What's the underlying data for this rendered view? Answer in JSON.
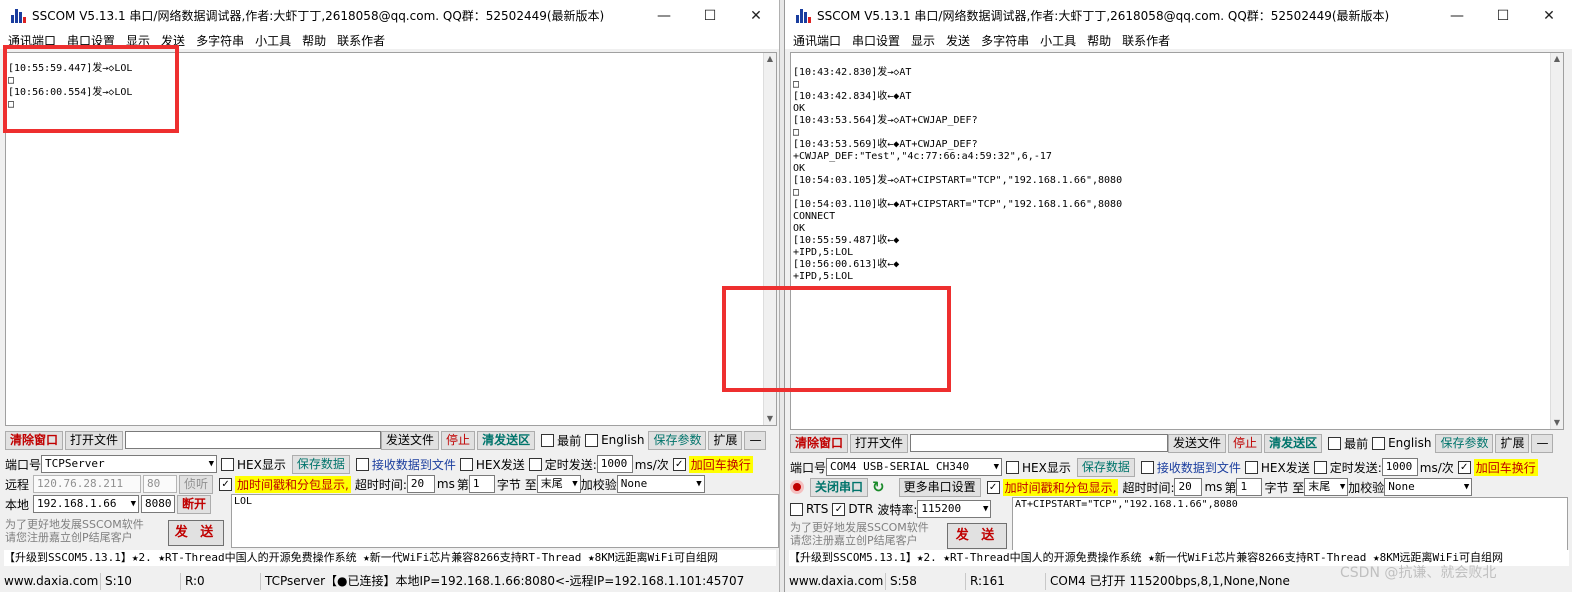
{
  "left": {
    "title": "SSCOM V5.13.1 串口/网络数据调试器,作者:大虾丁丁,2618058@qq.com. QQ群：52502449(最新版本)",
    "menu": [
      "通讯端口",
      "串口设置",
      "显示",
      "发送",
      "多字符串",
      "小工具",
      "帮助",
      "联系作者"
    ],
    "log": [
      "[10:55:59.447]发→◇LOL",
      "□",
      "[10:56:00.554]发→◇LOL",
      "□"
    ],
    "toolbar": {
      "clear": "清除窗口",
      "open_file": "打开文件",
      "send_file": "发送文件",
      "stop": "停止",
      "clear_send": "清发送区",
      "top": "最前",
      "english": "English",
      "save_params": "保存参数",
      "expand": "扩展",
      "collapse": "—"
    },
    "port_label": "端口号",
    "port_value": "TCPServer",
    "hex_display": "HEX显示",
    "save_data": "保存数据",
    "recv_to_file": "接收数据到文件",
    "hex_send": "HEX发送",
    "timed_send": "定时发送:",
    "interval": "1000",
    "interval_unit": "ms/次",
    "add_crlf": "加回车换行",
    "remote_label": "远程",
    "remote_ip": "120.76.28.211",
    "remote_port": "80",
    "listen": "侦听",
    "timestamp_label": "加时间戳和分包显示,",
    "timeout_label": "超时时间:",
    "timeout": "20",
    "timeout_unit": "ms",
    "seg_label": "第",
    "seg_value": "1",
    "byte_to": "字节 至",
    "tail": "末尾",
    "checksum_label": "加校验",
    "checksum": "None",
    "local_label": "本地",
    "local_ip": "192.168.1.66",
    "local_port": "8080",
    "disconnect": "断开",
    "send_text": "LOL",
    "promo_line1": "为了更好地发展SSCOM软件",
    "promo_line2": "请您注册嘉立创P结尾客户",
    "send_button": "发 送",
    "ticker": "【升级到SSCOM5.13.1】★2. ★RT-Thread中国人的开源免费操作系统 ★新一代WiFi芯片兼容8266支持RT-Thread ★8KM远距离WiFi可自组网",
    "status": {
      "site": "www.daxia.com",
      "sent": "S:10",
      "recv": "R:0",
      "info": "TCPserver【●已连接】本地IP=192.168.1.66:8080<-远程IP=192.168.1.101:45707"
    }
  },
  "right": {
    "title": "SSCOM V5.13.1 串口/网络数据调试器,作者:大虾丁丁,2618058@qq.com. QQ群：52502449(最新版本)",
    "menu": [
      "通讯端口",
      "串口设置",
      "显示",
      "发送",
      "多字符串",
      "小工具",
      "帮助",
      "联系作者"
    ],
    "log": [
      "[10:43:42.830]发→◇AT",
      "□",
      "[10:43:42.834]收←◆AT",
      "",
      "OK",
      "",
      "[10:43:53.564]发→◇AT+CWJAP_DEF?",
      "□",
      "[10:43:53.569]收←◆AT+CWJAP_DEF?",
      "+CWJAP_DEF:\"Test\",\"4c:77:66:a4:59:32\",6,-17",
      "",
      "OK",
      "",
      "[10:54:03.105]发→◇AT+CIPSTART=\"TCP\",\"192.168.1.66\",8080",
      "□",
      "[10:54:03.110]收←◆AT+CIPSTART=\"TCP\",\"192.168.1.66\",8080",
      "CONNECT",
      "",
      "OK",
      "",
      "[10:55:59.487]收←◆",
      "+IPD,5:LOL",
      "",
      "[10:56:00.613]收←◆",
      "+IPD,5:LOL"
    ],
    "toolbar": {
      "clear": "清除窗口",
      "open_file": "打开文件",
      "send_file": "发送文件",
      "stop": "停止",
      "clear_send": "清发送区",
      "top": "最前",
      "english": "English",
      "save_params": "保存参数",
      "expand": "扩展",
      "collapse": "—"
    },
    "port_label": "端口号",
    "port_value": "COM4 USB-SERIAL CH340",
    "hex_display": "HEX显示",
    "save_data": "保存数据",
    "recv_to_file": "接收数据到文件",
    "hex_send": "HEX发送",
    "timed_send": "定时发送:",
    "interval": "1000",
    "interval_unit": "ms/次",
    "add_crlf": "加回车换行",
    "close_port": "关闭串口",
    "more_settings": "更多串口设置",
    "timestamp_label": "加时间戳和分包显示,",
    "timeout_label": "超时时间:",
    "timeout": "20",
    "timeout_unit": "ms",
    "seg_label": "第",
    "seg_value": "1",
    "byte_to": "字节 至",
    "tail": "末尾",
    "checksum_label": "加校验",
    "checksum": "None",
    "rts": "RTS",
    "dtr": "DTR",
    "baud_label": "波特率:",
    "baud": "115200",
    "send_text": "AT+CIPSTART=\"TCP\",\"192.168.1.66\",8080",
    "promo_line1": "为了更好地发展SSCOM软件",
    "promo_line2": "请您注册嘉立创P结尾客户",
    "send_button": "发 送",
    "ticker": "【升级到SSCOM5.13.1】★2. ★RT-Thread中国人的开源免费操作系统 ★新一代WiFi芯片兼容8266支持RT-Thread ★8KM远距离WiFi可自组网",
    "status": {
      "site": "www.daxia.com",
      "sent": "S:58",
      "recv": "R:161",
      "info": "COM4 已打开  115200bps,8,1,None,None"
    }
  },
  "watermark": "CSDN @抗谦、就会败北",
  "colors": {
    "highlight_box": "#ee2f2f",
    "accent_red": "#c00000",
    "teal": "#00746b",
    "yellow": "#ffff00"
  }
}
